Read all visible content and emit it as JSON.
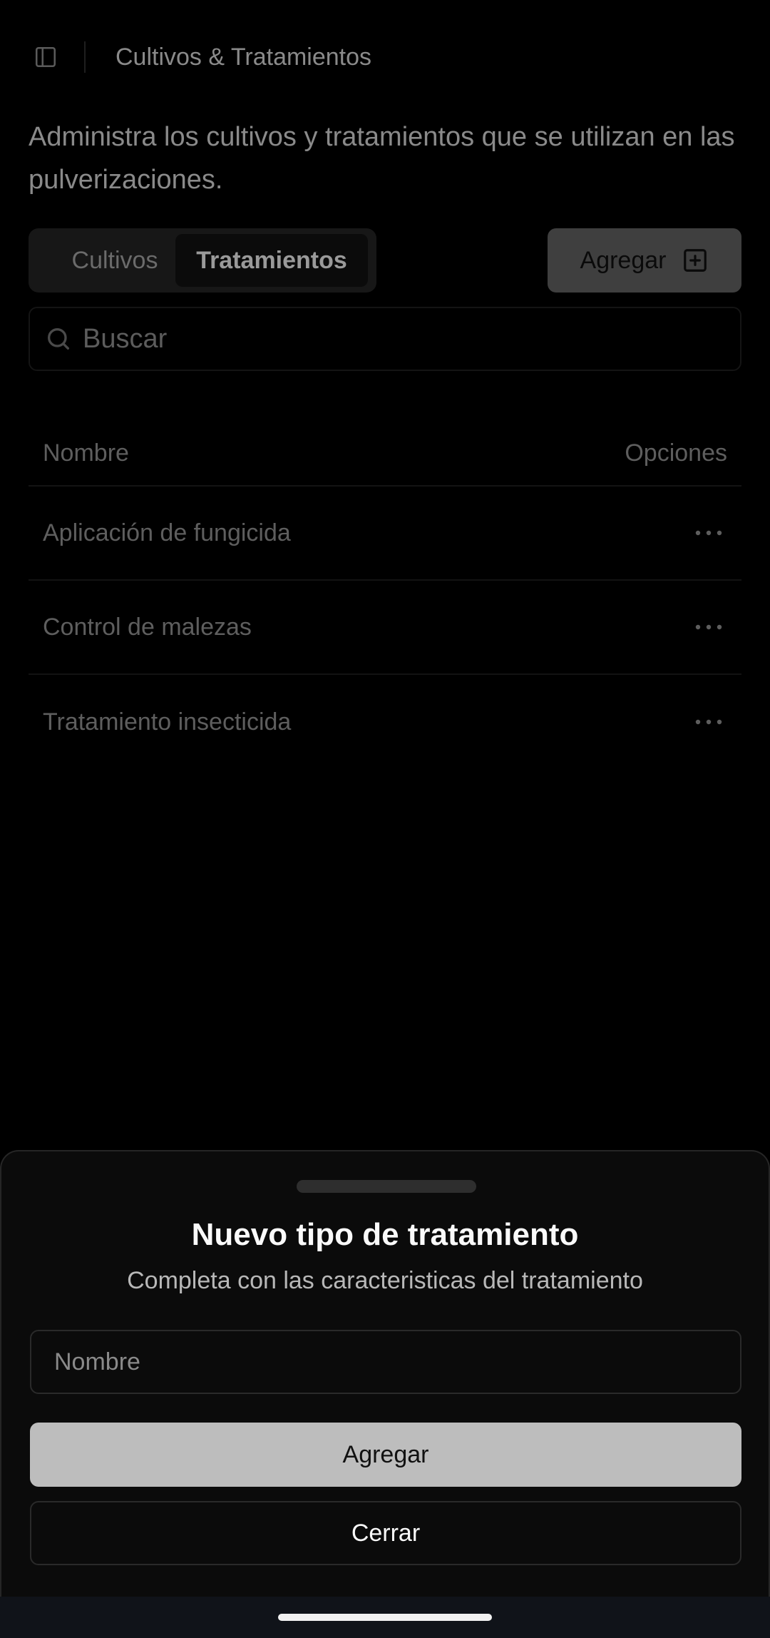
{
  "header": {
    "title": "Cultivos & Tratamientos",
    "sidebar_icon": "sidebar-toggle-icon"
  },
  "description": "Administra los cultivos y tratamientos que se utilizan en las pulverizaciones.",
  "tabs": [
    {
      "label": "Cultivos",
      "active": false
    },
    {
      "label": "Tratamientos",
      "active": true
    }
  ],
  "toolbar": {
    "add_label": "Agregar",
    "add_icon": "plus-square-icon"
  },
  "search": {
    "placeholder": "Buscar",
    "icon": "search-icon"
  },
  "table": {
    "columns": [
      "Nombre",
      "Opciones"
    ],
    "rows": [
      {
        "name": "Aplicación de fungicida"
      },
      {
        "name": "Control de malezas"
      },
      {
        "name": "Tratamiento insecticida"
      }
    ]
  },
  "sheet": {
    "title": "Nuevo tipo de tratamiento",
    "subtitle": "Completa con las caracteristicas del tratamiento",
    "name_placeholder": "Nombre",
    "submit_label": "Agregar",
    "close_label": "Cerrar"
  },
  "colors": {
    "background": "#000000",
    "sheet_background": "#0b0b0b",
    "primary_button": "#bdbdbd",
    "navbar": "#101319"
  }
}
